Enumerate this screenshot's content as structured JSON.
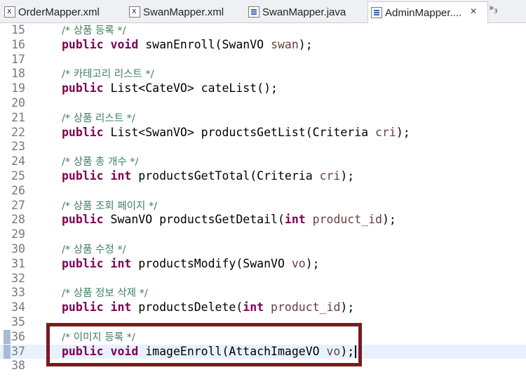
{
  "tabs": [
    {
      "label": "OrderMapper.xml",
      "icon": "xml-file-icon"
    },
    {
      "label": "SwanMapper.xml",
      "icon": "xml-file-icon"
    },
    {
      "label": "SwanMapper.java",
      "icon": "java-file-icon"
    },
    {
      "label": "AdminMapper....",
      "icon": "java-file-icon",
      "active": true
    }
  ],
  "tab_close": "✕",
  "overflow": {
    "symbol": "»",
    "count": "3"
  },
  "lines": [
    {
      "num": "15",
      "comment": "/* 상품 등록 */"
    },
    {
      "num": "16",
      "kw": "public void",
      "rest": " swanEnroll(SwanVO ",
      "param": "swan",
      "end": ");"
    },
    {
      "num": "17"
    },
    {
      "num": "18",
      "comment": "/* 카테고리 리스트 */"
    },
    {
      "num": "19",
      "kw": "public",
      "rest": " List<CateVO> cateList();"
    },
    {
      "num": "20"
    },
    {
      "num": "21",
      "comment": "/* 상품 리스트 */"
    },
    {
      "num": "22",
      "kw": "public",
      "rest": " List<SwanVO> productsGetList(Criteria ",
      "param": "cri",
      "end": ");"
    },
    {
      "num": "23"
    },
    {
      "num": "24",
      "comment": "/* 상품 총 개수 */"
    },
    {
      "num": "25",
      "kw": "public int",
      "rest": " productsGetTotal(Criteria ",
      "param": "cri",
      "end": ");"
    },
    {
      "num": "26"
    },
    {
      "num": "27",
      "comment": "/* 상품 조회 페이지 */"
    },
    {
      "num": "28",
      "kw": "public",
      "rest": " SwanVO productsGetDetail(",
      "kw2": "int",
      "rest2": " ",
      "param": "product_id",
      "end": ");"
    },
    {
      "num": "29"
    },
    {
      "num": "30",
      "comment": "/* 상품 수정 */"
    },
    {
      "num": "31",
      "kw": "public int",
      "rest": " productsModify(SwanVO ",
      "param": "vo",
      "end": ");"
    },
    {
      "num": "32"
    },
    {
      "num": "33",
      "comment": "/* 상품 정보 삭제 */"
    },
    {
      "num": "34",
      "kw": "public int",
      "rest": " productsDelete(",
      "kw2": "int",
      "rest2": " ",
      "param": "product_id",
      "end": ");"
    },
    {
      "num": "35"
    },
    {
      "num": "36",
      "comment": "/* 이미지 등록 */"
    },
    {
      "num": "37",
      "kw": "public void",
      "rest": " imageEnroll(AttachImageVO ",
      "param": "vo",
      "end": ");"
    },
    {
      "num": "38"
    }
  ]
}
